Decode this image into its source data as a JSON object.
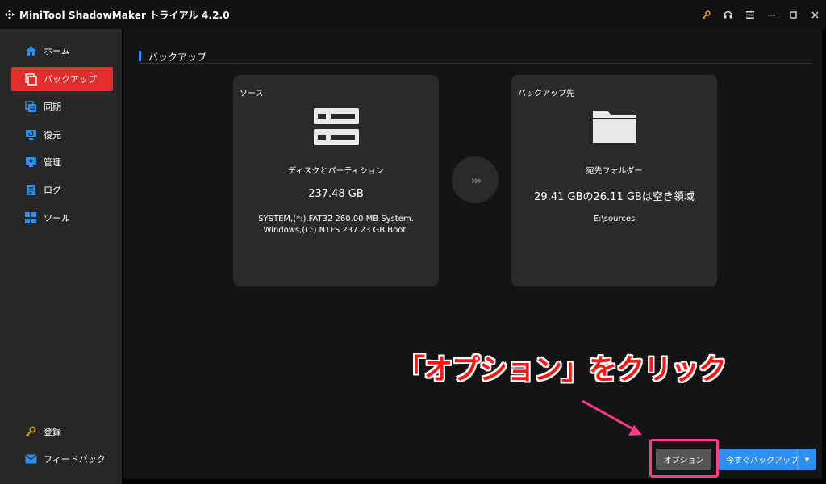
{
  "window": {
    "title": "MiniTool ShadowMaker トライアル 4.2.0"
  },
  "titlebar_icons": [
    "key-icon",
    "headset-icon",
    "menu-icon",
    "minimize-icon",
    "maximize-icon",
    "close-icon"
  ],
  "sidebar": {
    "items": [
      {
        "label": "ホーム",
        "icon": "home-icon",
        "active": false
      },
      {
        "label": "バックアップ",
        "icon": "backup-icon",
        "active": true
      },
      {
        "label": "同期",
        "icon": "sync-icon",
        "active": false
      },
      {
        "label": "復元",
        "icon": "restore-icon",
        "active": false
      },
      {
        "label": "管理",
        "icon": "manage-icon",
        "active": false
      },
      {
        "label": "ログ",
        "icon": "log-icon",
        "active": false
      },
      {
        "label": "ツール",
        "icon": "tools-icon",
        "active": false
      }
    ],
    "bottom_items": [
      {
        "label": "登録",
        "icon": "key-icon"
      },
      {
        "label": "フィードバック",
        "icon": "mail-icon"
      }
    ]
  },
  "main": {
    "section_title": "バックアップ",
    "source": {
      "label": "ソース",
      "type": "ディスクとパーティション",
      "size": "237.48 GB",
      "detail_line1": "SYSTEM,(*:).FAT32 260.00 MB System.",
      "detail_line2": "Windows,(C:).NTFS 237.23 GB Boot."
    },
    "destination": {
      "label": "バックアップ先",
      "type": "宛先フォルダー",
      "size": "29.41 GBの26.11 GBは空き領域",
      "path": "E:\\sources"
    },
    "options_button": "オプション",
    "backup_now_button": "今すぐバックアップ",
    "annotation": "「オプション」をクリック"
  },
  "colors": {
    "accent_red": "#e02e2e",
    "accent_blue": "#2f8ff0",
    "highlight_pink": "#ff3a8c"
  }
}
